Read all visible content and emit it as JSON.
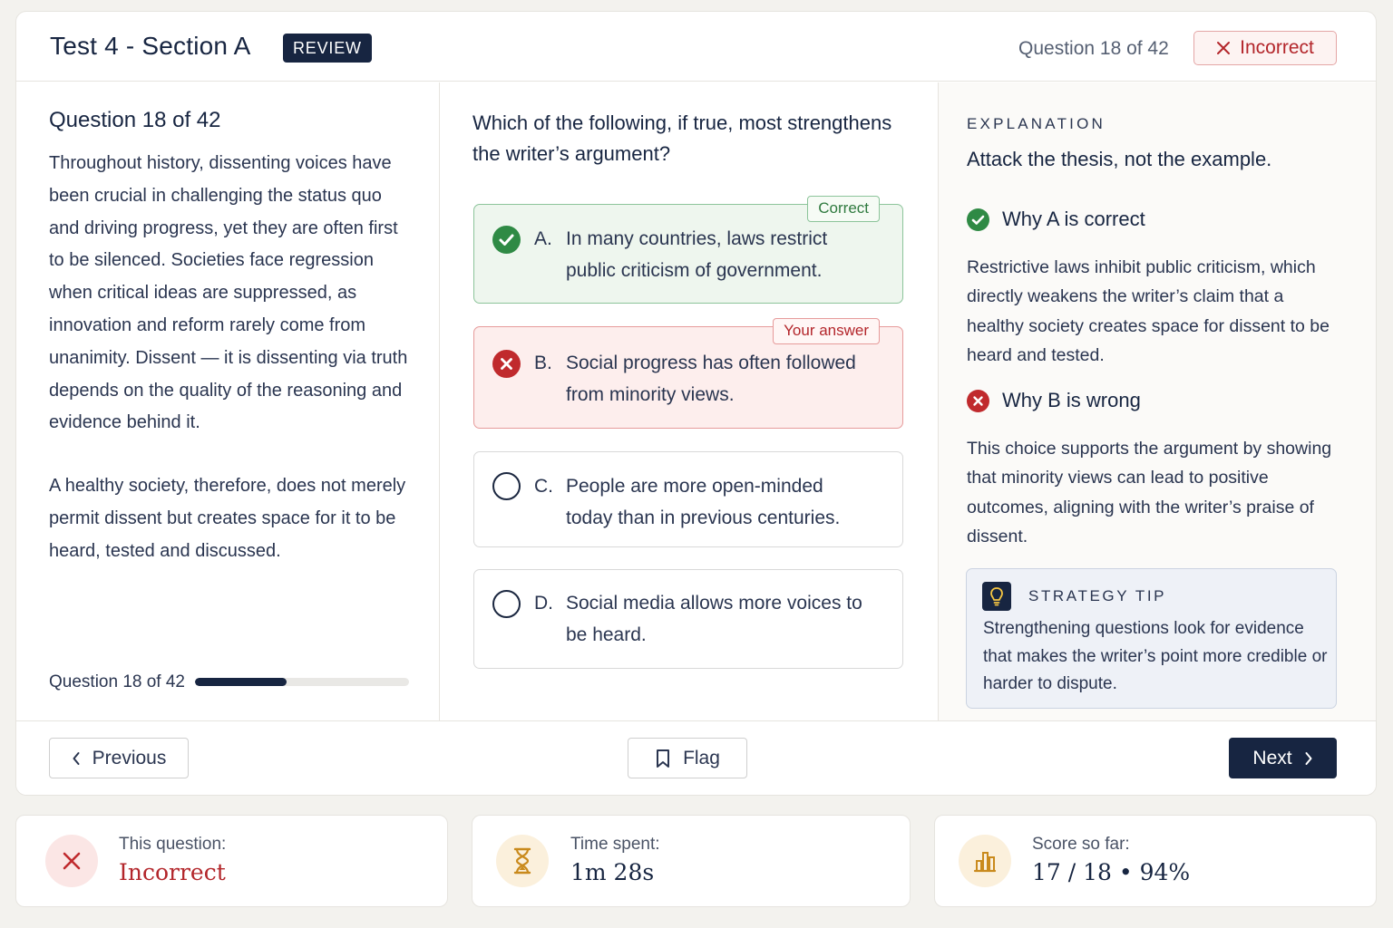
{
  "header": {
    "title": "Test 4 - Section A",
    "badge": "REVIEW",
    "counter": "Question 18 of 42",
    "status": "Incorrect"
  },
  "passage": {
    "heading": "Question 18 of 42",
    "paragraphs": [
      "Throughout history, dissenting voices have been crucial in challenging the status quo and driving progress, yet they are often first to be silenced. Societies face regression when critical ideas are suppressed, as innovation and reform rarely come from unanimity. Dissent — it is dissenting via truth depends on the quality of the reasoning and evidence behind it.",
      "A healthy society, therefore, does not merely permit dissent but creates space for it to be heard, tested and discussed."
    ],
    "progress_label": "Question 18 of 42",
    "progress_fraction": 0.4286
  },
  "question": {
    "text": "Which of the following, if true, most strengthens the writer’s argument?",
    "choices": [
      {
        "letter": "A.",
        "text": "In many countries, laws restrict public criticism of government.",
        "state": "correct",
        "tag": "Correct"
      },
      {
        "letter": "B.",
        "text": "Social progress has often followed from minority views.",
        "state": "wrong",
        "tag": "Your answer"
      },
      {
        "letter": "C.",
        "text": "People are more open-minded today than in previous centuries.",
        "state": "neutral"
      },
      {
        "letter": "D.",
        "text": "Social media allows more voices to be heard.",
        "state": "neutral"
      }
    ]
  },
  "explanation": {
    "kicker": "EXPLANATION",
    "title": "Attack the thesis, not the example.",
    "why_correct_title": "Why A is correct",
    "why_correct_body": "Restrictive laws inhibit public criticism, which directly weakens the writer’s claim that a healthy society creates space for dissent to be heard and tested.",
    "why_wrong_title": "Why B is wrong",
    "why_wrong_body": "This choice supports the argument by showing that minority views can lead to positive outcomes, aligning with the writer’s praise of dissent.",
    "tip_label": "STRATEGY TIP",
    "tip_text": "Strengthening questions look for evidence that makes the writer’s point more credible or harder to dispute."
  },
  "footer": {
    "previous": "Previous",
    "flag": "Flag",
    "next": "Next"
  },
  "stats": [
    {
      "label": "This question:",
      "value": "Incorrect",
      "icon": "x-icon",
      "value_color": "#b3262b"
    },
    {
      "label": "Time spent:",
      "value": "1m 28s",
      "icon": "hourglass-icon",
      "value_color": "#172541"
    },
    {
      "label": "Score so far:",
      "value": "17 / 18 • 94%",
      "icon": "bar-chart-icon",
      "value_color": "#172541"
    }
  ],
  "colors": {
    "navy": "#172541",
    "correct": "#2f8a45",
    "incorrect": "#c02a2d"
  }
}
